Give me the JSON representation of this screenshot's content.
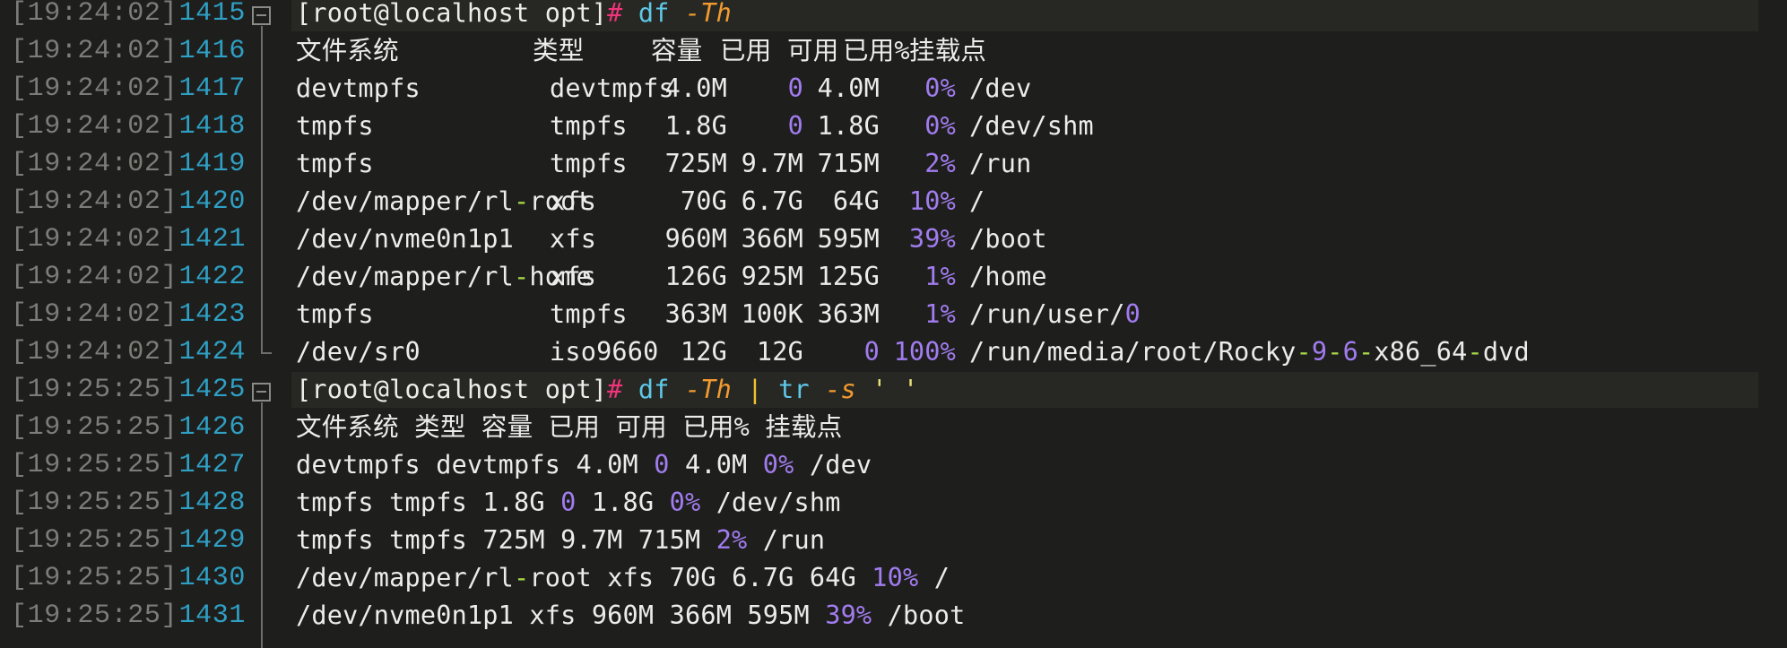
{
  "terminal": {
    "lines": [
      {
        "time": "19:24:02",
        "no": "1415",
        "type": "cmd",
        "prompt": "[root@localhost opt]",
        "hash": "#",
        "cmd": "df",
        "flag": "-Th"
      },
      {
        "time": "19:24:02",
        "no": "1416",
        "type": "header",
        "cols": [
          "文件系统",
          "类型",
          "容量",
          "已用",
          "可用",
          "已用%",
          "挂载点"
        ]
      },
      {
        "time": "19:24:02",
        "no": "1417",
        "type": "row",
        "fs": "devtmpfs",
        "fstype": "devtmpfs",
        "size": "4.0M",
        "used": "0",
        "avail": "4.0M",
        "pct": "0%",
        "mount": "/dev"
      },
      {
        "time": "19:24:02",
        "no": "1418",
        "type": "row",
        "fs": "tmpfs",
        "fstype": "tmpfs",
        "size": "1.8G",
        "used": "0",
        "avail": "1.8G",
        "pct": "0%",
        "mount": "/dev/shm"
      },
      {
        "time": "19:24:02",
        "no": "1419",
        "type": "row",
        "fs": "tmpfs",
        "fstype": "tmpfs",
        "size": "725M",
        "used": "9.7M",
        "avail": "715M",
        "pct": "2%",
        "mount": "/run"
      },
      {
        "time": "19:24:02",
        "no": "1420",
        "type": "row",
        "fs": "/dev/mapper/rl-root",
        "fstype": "xfs",
        "size": "70G",
        "used": "6.7G",
        "avail": "64G",
        "pct": "10%",
        "mount": "/"
      },
      {
        "time": "19:24:02",
        "no": "1421",
        "type": "row",
        "fs": "/dev/nvme0n1p1",
        "fstype": "xfs",
        "size": "960M",
        "used": "366M",
        "avail": "595M",
        "pct": "39%",
        "mount": "/boot"
      },
      {
        "time": "19:24:02",
        "no": "1422",
        "type": "row",
        "fs": "/dev/mapper/rl-home",
        "fstype": "xfs",
        "size": "126G",
        "used": "925M",
        "avail": "125G",
        "pct": "1%",
        "mount": "/home"
      },
      {
        "time": "19:24:02",
        "no": "1423",
        "type": "row",
        "fs": "tmpfs",
        "fstype": "tmpfs",
        "size": "363M",
        "used": "100K",
        "avail": "363M",
        "pct": "1%",
        "mount": "/run/user/0"
      },
      {
        "time": "19:24:02",
        "no": "1424",
        "type": "row",
        "fs": "/dev/sr0",
        "fstype": "iso9660",
        "size": "12G",
        "used": "12G",
        "avail": "0",
        "pct": "100%",
        "mount": "/run/media/root/Rocky-9-6-x86_64-dvd"
      },
      {
        "time": "19:25:25",
        "no": "1425",
        "type": "cmd",
        "prompt": "[root@localhost opt]",
        "hash": "#",
        "cmd": "df",
        "flag": "-Th",
        "pipe": "|",
        "cmd2": "tr",
        "flag2": "-s",
        "arg": "' '"
      },
      {
        "time": "19:25:25",
        "no": "1426",
        "type": "plain",
        "text": "文件系统 类型 容量 已用 可用 已用% 挂载点"
      },
      {
        "time": "19:25:25",
        "no": "1427",
        "type": "squeezed",
        "fs": "devtmpfs",
        "fstype": "devtmpfs",
        "size": "4.0M",
        "used": "0",
        "avail": "4.0M",
        "pct": "0%",
        "mount": "/dev"
      },
      {
        "time": "19:25:25",
        "no": "1428",
        "type": "squeezed",
        "fs": "tmpfs",
        "fstype": "tmpfs",
        "size": "1.8G",
        "used": "0",
        "avail": "1.8G",
        "pct": "0%",
        "mount": "/dev/shm"
      },
      {
        "time": "19:25:25",
        "no": "1429",
        "type": "squeezed",
        "fs": "tmpfs",
        "fstype": "tmpfs",
        "size": "725M",
        "used": "9.7M",
        "avail": "715M",
        "pct": "2%",
        "mount": "/run"
      },
      {
        "time": "19:25:25",
        "no": "1430",
        "type": "squeezed",
        "fs": "/dev/mapper/rl-root",
        "fstype": "xfs",
        "size": "70G",
        "used": "6.7G",
        "avail": "64G",
        "pct": "10%",
        "mount": "/"
      },
      {
        "time": "19:25:25",
        "no": "1431",
        "type": "squeezed",
        "fs": "/dev/nvme0n1p1",
        "fstype": "xfs",
        "size": "960M",
        "used": "366M",
        "avail": "595M",
        "pct": "39%",
        "mount": "/boot"
      }
    ]
  },
  "colors": {
    "background": "#1e1f1c",
    "timestamp": "#7c7c78",
    "line_number": "#2f9fc4",
    "prompt_hash": "#f0337a",
    "command": "#5ec8e8",
    "flag": "#f29a2e",
    "pipe": "#f2c12e",
    "number": "#a27cf0",
    "dash": "#a8d848"
  }
}
